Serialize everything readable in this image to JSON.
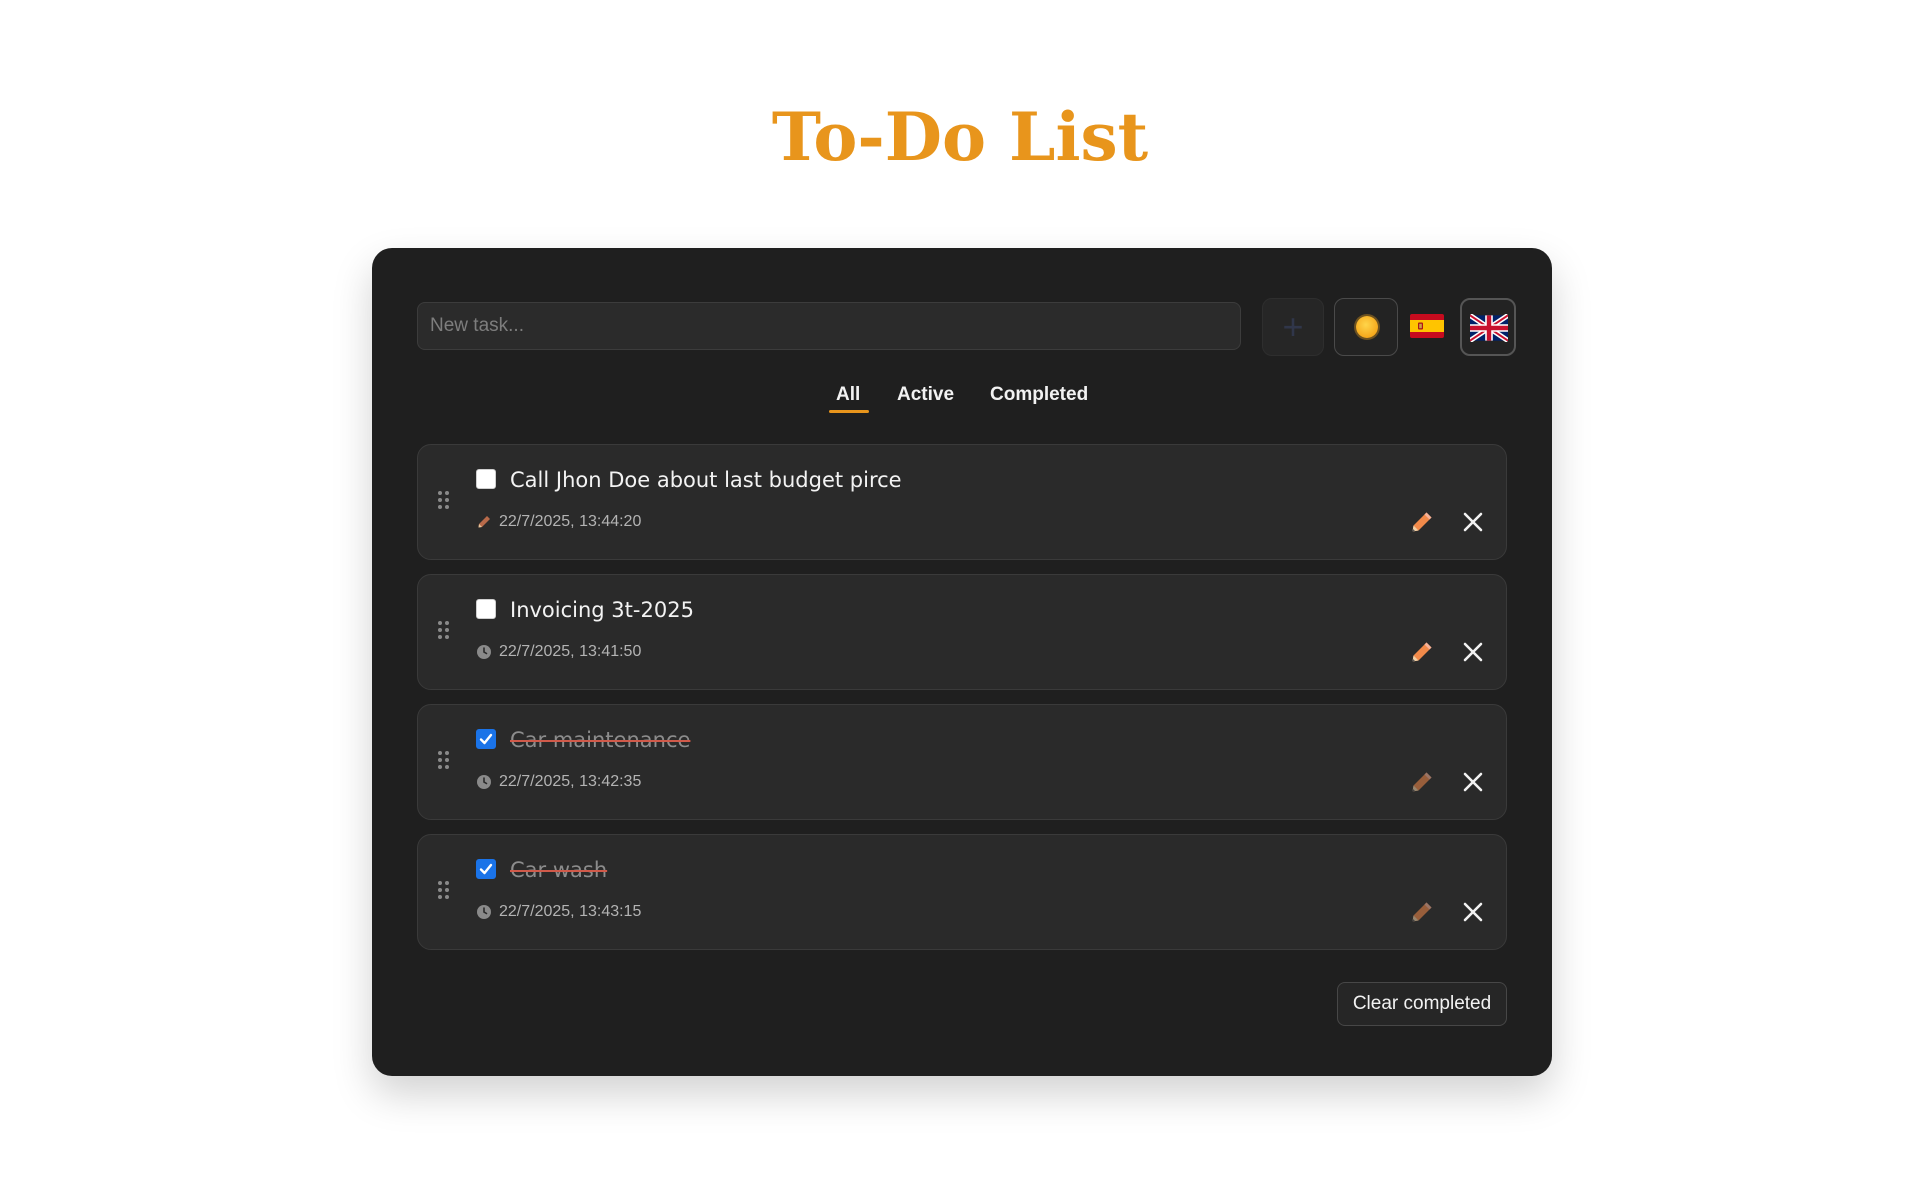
{
  "page": {
    "title": "To-Do List"
  },
  "input": {
    "placeholder": "New task...",
    "value": ""
  },
  "toolbar": {
    "add_icon": "plus-icon",
    "add_label": "+",
    "theme_icon": "sun-icon",
    "languages": [
      "spain-flag-icon",
      "uk-flag-icon"
    ],
    "active_language": "uk-flag-icon"
  },
  "filters": {
    "tabs": [
      {
        "label": "All",
        "active": true
      },
      {
        "label": "Active",
        "active": false
      },
      {
        "label": "Completed",
        "active": false
      }
    ]
  },
  "tasks": [
    {
      "text": "Call Jhon Doe about last budget pirce",
      "completed": false,
      "meta_icon": "pencil-icon",
      "timestamp": "22/7/2025, 13:44:20"
    },
    {
      "text": "Invoicing 3t-2025",
      "completed": false,
      "meta_icon": "clock-icon",
      "timestamp": "22/7/2025, 13:41:50"
    },
    {
      "text": "Car maintenance",
      "completed": true,
      "meta_icon": "clock-icon",
      "timestamp": "22/7/2025, 13:42:35"
    },
    {
      "text": "Car wash",
      "completed": true,
      "meta_icon": "clock-icon",
      "timestamp": "22/7/2025, 13:43:15"
    }
  ],
  "actions": {
    "clear_completed_label": "Clear completed"
  },
  "colors": {
    "accent": "#e8951c",
    "card_background": "#1f1f1f",
    "item_background": "#2a2a2a",
    "checkbox_checked": "#1a73e8",
    "pencil": "#f28a4a",
    "strikethrough": "#d05a4a"
  }
}
